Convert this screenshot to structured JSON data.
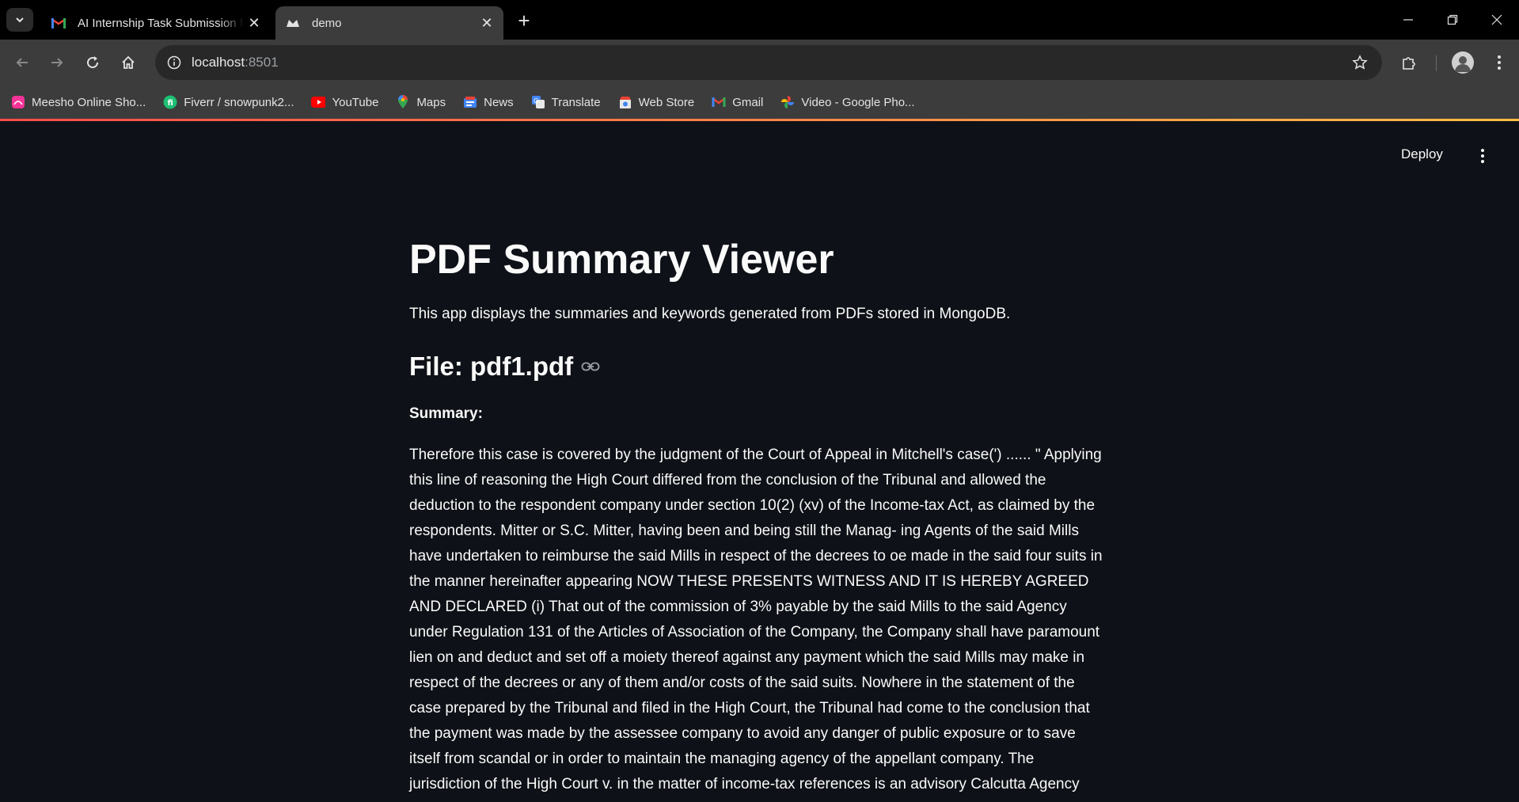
{
  "browser": {
    "tabs": [
      {
        "title": "AI Internship Task Submission for",
        "icon": "gmail-icon",
        "active": false
      },
      {
        "title": "demo",
        "icon": "streamlit-icon",
        "active": true
      }
    ],
    "address": {
      "host": "localhost",
      "port": ":8501"
    },
    "bookmarks": [
      {
        "label": "Meesho Online Sho...",
        "icon": "meesho-icon",
        "color": "#f43397"
      },
      {
        "label": "Fiverr / snowpunk2...",
        "icon": "fiverr-icon",
        "color": "#1dbf73"
      },
      {
        "label": "YouTube",
        "icon": "youtube-icon",
        "color": "#ff0000"
      },
      {
        "label": "Maps",
        "icon": "maps-icon",
        "color": "#34a853"
      },
      {
        "label": "News",
        "icon": "news-icon",
        "color": "#4285f4"
      },
      {
        "label": "Translate",
        "icon": "translate-icon",
        "color": "#4285f4"
      },
      {
        "label": "Web Store",
        "icon": "webstore-icon",
        "color": "#ea4335"
      },
      {
        "label": "Gmail",
        "icon": "gmail-icon",
        "color": "#ea4335"
      },
      {
        "label": "Video - Google Pho...",
        "icon": "photos-icon",
        "color": "#fbbc04"
      }
    ]
  },
  "app": {
    "deploy_label": "Deploy",
    "title": "PDF Summary Viewer",
    "description": "This app displays the summaries and keywords generated from PDFs stored in MongoDB.",
    "file_heading": "File: pdf1.pdf",
    "summary_label": "Summary:",
    "summary_text": "Therefore this case is covered by the judgment of the Court of Appeal in Mitchell's case(') ...... \" Applying this line of reasoning the High Court differed from the conclusion of the Tribunal and allowed the deduction to the respondent company under section 10(2) (xv) of the Income-tax Act, as claimed by the respondents. Mitter or S.C. Mitter, having been and being still the Manag- ing Agents of the said Mills have undertaken to reimburse the said Mills in respect of the decrees to oe made in the said four suits in the manner hereinafter appearing NOW THESE PRESENTS WITNESS AND IT IS HEREBY AGREED AND DECLARED (i) That out of the commission of 3% payable by the said Mills to the said Agency under Regulation 131 of the Articles of Association of the Company, the Company shall have paramount lien on and deduct and set off a moiety thereof against any payment which the said Mills may make in respect of the decrees or any of them and/or costs of the said suits. Nowhere in the statement of the case prepared by the Tribunal and filed in the High Court, the Tribunal had come to the conclusion that the payment was made by the assessee company to avoid any danger of public exposure or to save itself from scandal or in order to maintain the managing agency of the appellant company. The jurisdiction of the High Court v. in the matter of income-tax references is an advisory Calcutta Agency jurisdiction and under the Act the"
  },
  "colors": {
    "page_bg": "#0e1117",
    "text": "#fafafa",
    "accent_start": "#ff4b4b",
    "accent_end": "#ffbd45"
  }
}
